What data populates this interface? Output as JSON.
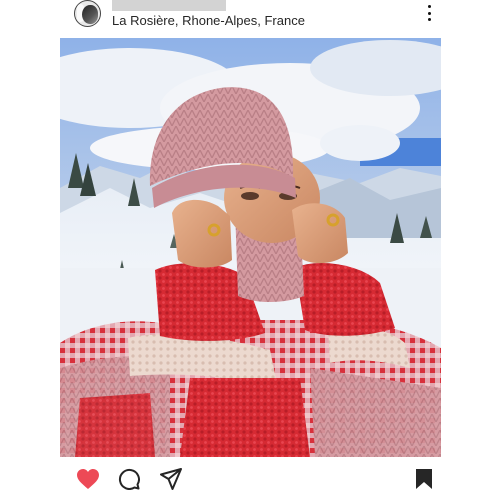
{
  "post": {
    "location": "La Rosière, Rhone-Alpes, France"
  },
  "colors": {
    "like": "#ed4956",
    "icon": "#262626",
    "username_redacted": "#d3d3d3"
  },
  "icons": {
    "more": "more-vertical-icon",
    "like": "heart-filled-icon",
    "comment": "comment-bubble-icon",
    "share": "send-paper-plane-icon",
    "save": "bookmark-filled-icon"
  }
}
